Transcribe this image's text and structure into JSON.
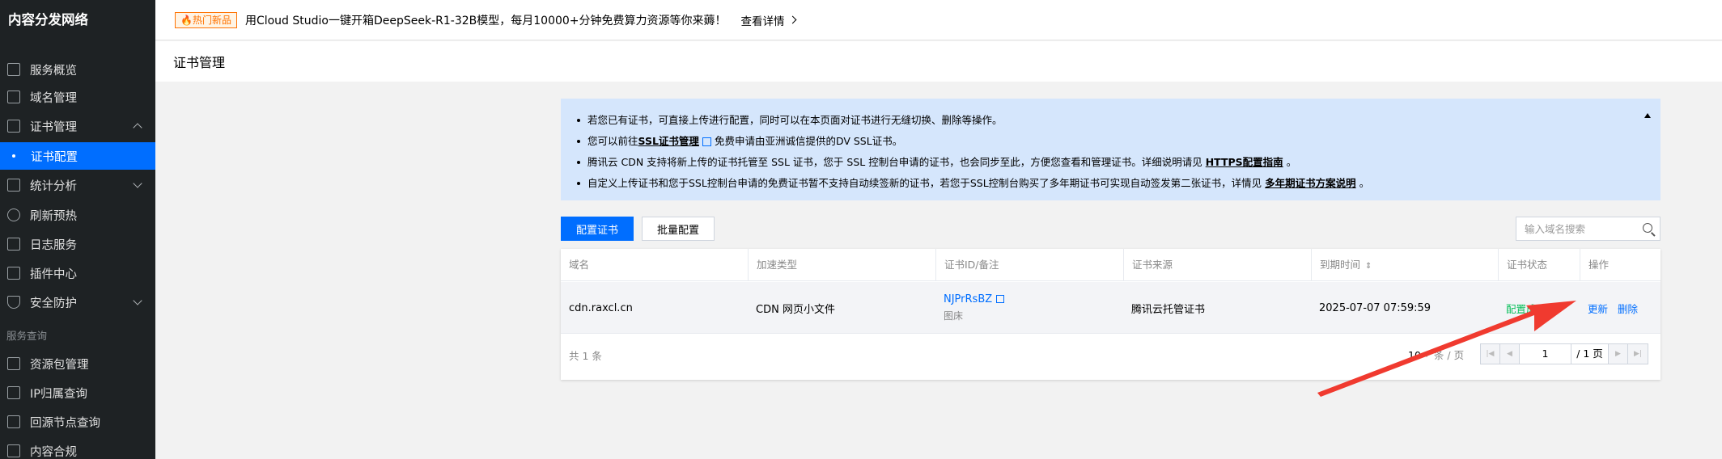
{
  "sidebar": {
    "title": "内容分发网络",
    "items": [
      {
        "label": "服务概览",
        "icon": "grid-icon"
      },
      {
        "label": "域名管理",
        "icon": "www-icon"
      },
      {
        "label": "证书管理",
        "icon": "certificate-icon"
      },
      {
        "label": "证书配置",
        "icon": "dot"
      },
      {
        "label": "统计分析",
        "icon": "bar-chart-icon"
      },
      {
        "label": "刷新预热",
        "icon": "refresh-icon"
      },
      {
        "label": "日志服务",
        "icon": "log-icon"
      },
      {
        "label": "插件中心",
        "icon": "plugin-icon"
      },
      {
        "label": "安全防护",
        "icon": "shield-icon"
      }
    ],
    "section_label": "服务查询",
    "section_items": [
      {
        "label": "资源包管理",
        "icon": "package-icon"
      },
      {
        "label": "IP归属查询",
        "icon": "ip-icon"
      },
      {
        "label": "回源节点查询",
        "icon": "origin-node-icon"
      },
      {
        "label": "内容合规",
        "icon": "compliance-icon"
      }
    ]
  },
  "banner": {
    "badge": "🔥热门新品",
    "text": "用Cloud Studio一键开箱DeepSeek-R1-32B模型，每月10000+分钟免费算力资源等你来薅！",
    "link": "查看详情"
  },
  "page": {
    "title": "证书管理"
  },
  "notice": {
    "items": [
      {
        "text": "若您已有证书，可直接上传进行配置，同时可以在本页面对证书进行无缝切换、删除等操作。"
      },
      {
        "pre": "您可以前往",
        "link": "SSL证书管理",
        "post": "免费申请由亚洲诚信提供的DV SSL证书。"
      },
      {
        "pre": "腾讯云 CDN 支持将新上传的证书托管至 SSL 证书，您于 SSL 控制台申请的证书，也会同步至此，方便您查看和管理证书。详细说明请见",
        "link": "HTTPS配置指南",
        "post": "。"
      },
      {
        "pre": "自定义上传证书和您于SSL控制台申请的免费证书暂不支持自动续签新的证书，若您于SSL控制台购买了多年期证书可实现自动签发第二张证书，详情见",
        "link": "多年期证书方案说明",
        "post": "。"
      }
    ]
  },
  "toolbar": {
    "primary_button": "配置证书",
    "secondary_button": "批量配置",
    "search_placeholder": "输入域名搜索"
  },
  "table": {
    "columns": [
      "域名",
      "加速类型",
      "证书ID/备注",
      "证书来源",
      "到期时间",
      "证书状态",
      "操作"
    ],
    "rows": [
      {
        "domain": "cdn.raxcl.cn",
        "type": "CDN 网页小文件",
        "cert_id": "NJPrRsBZ",
        "cert_note": "图床",
        "source": "腾讯云托管证书",
        "expiry": "2025-07-07 07:59:59",
        "status": "配置成功",
        "actions": [
          "更新",
          "删除"
        ]
      }
    ],
    "footer": {
      "total": "共 1 条",
      "page_size": "10",
      "page_size_unit": "条 / 页",
      "current_page": "1",
      "total_pages": "/ 1 页"
    }
  },
  "colors": {
    "accent": "#006eff",
    "sidebar_bg": "#1e2224",
    "notice_bg": "#d5e6fc",
    "status_ok": "#0abf5b",
    "annotation_arrow": "#f03a2f"
  }
}
